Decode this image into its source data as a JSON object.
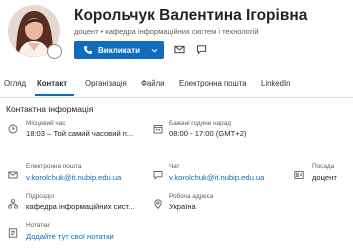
{
  "profile": {
    "name": "Корольчук Валентина Ігорівна",
    "subtitle": "доцент • кафедра інформаційних систем і технологій",
    "call_label": "Викликати"
  },
  "tabs": [
    {
      "label": "Огляд",
      "active": false
    },
    {
      "label": "Контакт",
      "active": true
    },
    {
      "label": "Організація",
      "active": false
    },
    {
      "label": "Файли",
      "active": false
    },
    {
      "label": "Електронна пошта",
      "active": false
    },
    {
      "label": "LinkedIn",
      "active": false
    }
  ],
  "contact": {
    "section_title": "Контактна інформація",
    "local_time": {
      "label": "Місцевий час",
      "value": "18:03 – Той самий часовий п..."
    },
    "working_hours": {
      "label": "Бажані години нарад",
      "value": "08:00 - 17:00 (GMT+2)"
    },
    "email": {
      "label": "Електронна пошта",
      "value": "v.korolchuk@it.nubip.edu.ua"
    },
    "chat": {
      "label": "Чат",
      "value": "v.korolchuk@it.nubip.edu.ua"
    },
    "position": {
      "label": "Посада",
      "value": "доцент"
    },
    "department": {
      "label": "Підрозділ",
      "value": "кафедра інформаційних сист..."
    },
    "work_address": {
      "label": "Робоча адреса",
      "value": "Україна"
    },
    "notes": {
      "label": "Нотатки",
      "value": "Додайте тут свої нотатки"
    }
  },
  "colors": {
    "accent": "#0f6cbd",
    "text": "#252423",
    "muted": "#605e5c"
  },
  "icons": [
    "phone-icon",
    "chevron-down-icon",
    "mail-icon",
    "chat-icon",
    "clock-icon",
    "calendar-icon",
    "contact-card-icon",
    "org-icon",
    "location-icon",
    "note-icon"
  ]
}
